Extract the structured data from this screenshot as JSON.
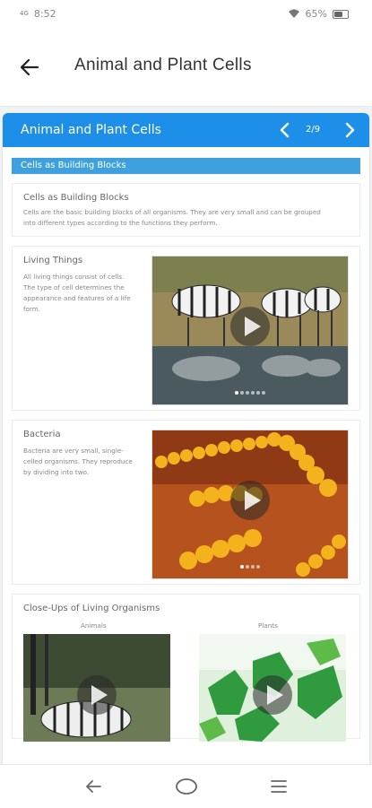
{
  "status": {
    "time": "8:52",
    "signal": "4G",
    "battery": "65%",
    "battery_level": 0.65
  },
  "app_bar": {
    "title": "Animal and Plant Cells"
  },
  "lesson": {
    "title": "Animal and Plant Cells",
    "page_indicator": "2/9",
    "section_title": "Cells as Building Blocks",
    "intro": {
      "heading": "Cells as Building Blocks",
      "text": "Cells are the basic building blocks of all organisms. They are very small and can be grouped into different types according to the functions they perform."
    },
    "living_things": {
      "heading": "Living Things",
      "text": "All living things consist of cells. The type of cell determines the appearance and features of a life form."
    },
    "bacteria": {
      "heading": "Bacteria",
      "text": "Bacteria are very small, single-celled organisms. They reproduce by dividing into two."
    },
    "organisms": {
      "heading": "Close-Ups of Living Organisms",
      "animals_label": "Animals",
      "plants_label": "Plants"
    }
  },
  "colors": {
    "accent": "#1e8fe8",
    "section": "#3ea0dc"
  }
}
